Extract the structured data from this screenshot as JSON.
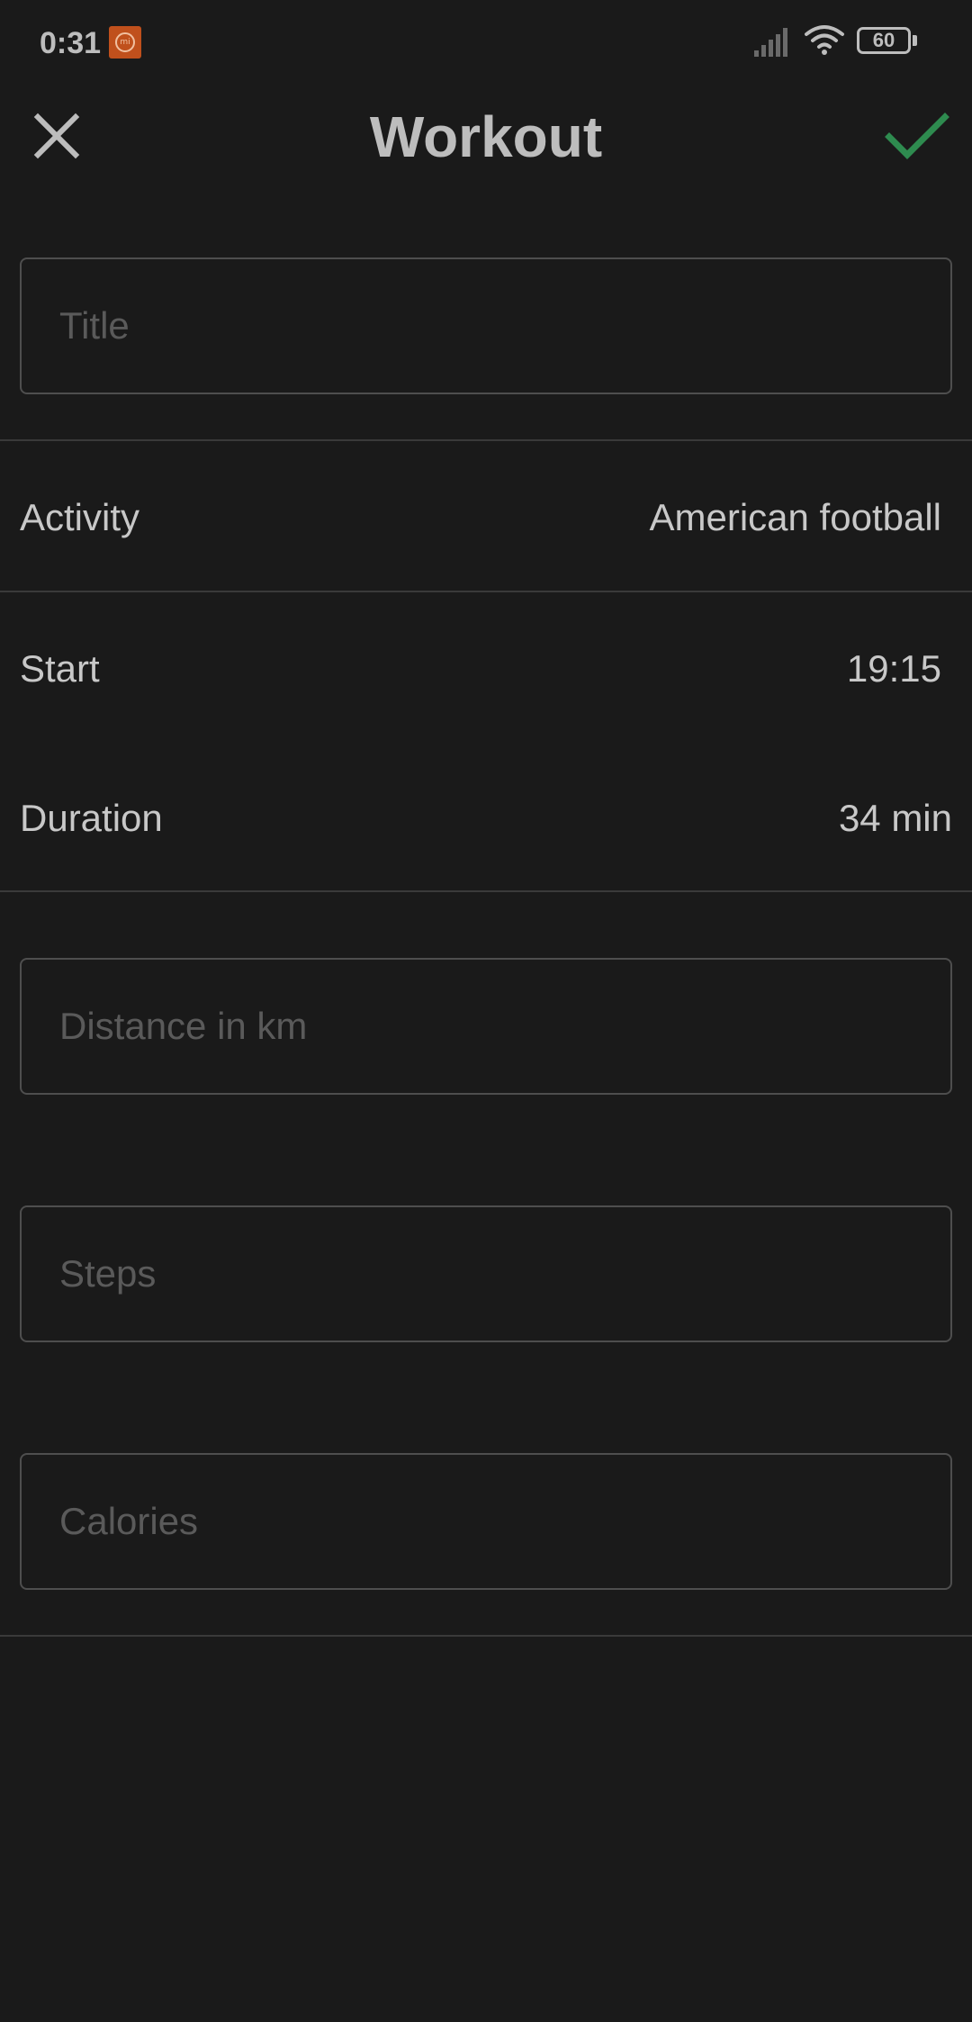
{
  "status_bar": {
    "time": "0:31",
    "battery": "60",
    "notification_icon": "mi-app-icon",
    "signal_icon": "cellular-signal-icon",
    "wifi_icon": "wifi-icon"
  },
  "header": {
    "title": "Workout",
    "close_icon": "close-icon",
    "confirm_icon": "checkmark-icon",
    "confirm_color": "#2e8b4f"
  },
  "title_field": {
    "placeholder": "Title",
    "value": ""
  },
  "activity": {
    "label": "Activity",
    "value": "American football"
  },
  "start": {
    "label": "Start",
    "value": "19:15"
  },
  "duration": {
    "label": "Duration",
    "value": "34 min"
  },
  "distance_field": {
    "placeholder": "Distance in km",
    "value": ""
  },
  "steps_field": {
    "placeholder": "Steps",
    "value": ""
  },
  "calories_field": {
    "placeholder": "Calories",
    "value": ""
  },
  "colors": {
    "background": "#1a1a1a",
    "text": "#c8c8c8",
    "placeholder": "#5a5a5a",
    "border": "#4e4e4e",
    "accent": "#2e8b4f"
  }
}
